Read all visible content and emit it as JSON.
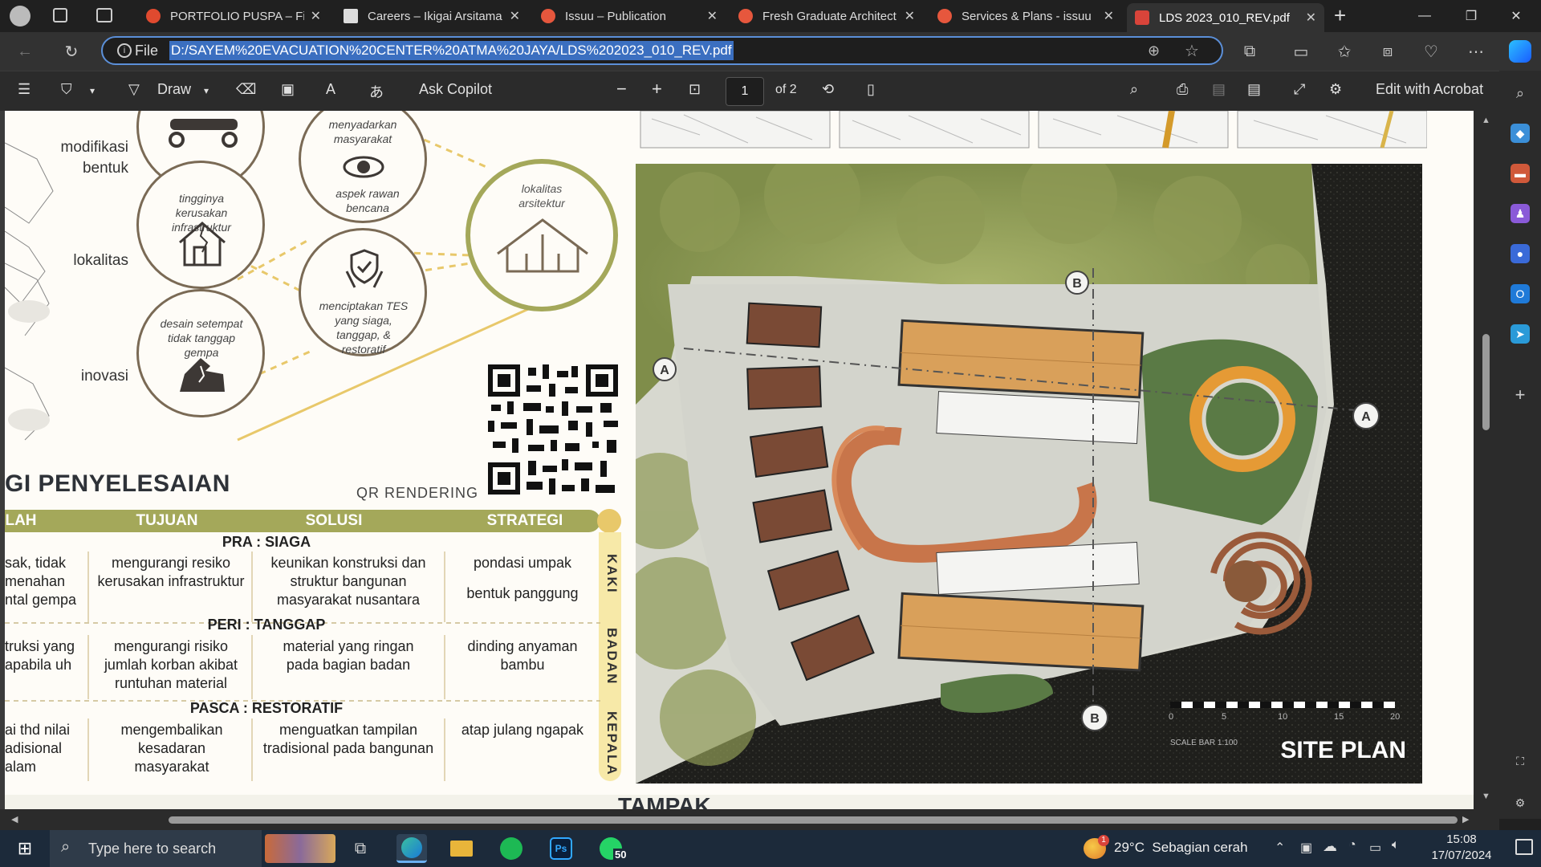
{
  "tabs": [
    {
      "label": "PORTFOLIO PUSPA – Figma",
      "favicon_color": "#e04a2f",
      "active": false
    },
    {
      "label": "Careers – Ikigai Arsitama",
      "favicon_color": "#dddddd",
      "active": false
    },
    {
      "label": "Issuu – Publication",
      "favicon_color": "#e6573d",
      "active": false
    },
    {
      "label": "Fresh Graduate Architect",
      "favicon_color": "#e6573d",
      "active": false
    },
    {
      "label": "Services & Plans - issuu",
      "favicon_color": "#e6573d",
      "active": false
    },
    {
      "label": "LDS 2023_010_REV.pdf",
      "favicon_color": "#d9443a",
      "active": true
    }
  ],
  "address": {
    "scheme_label": "File",
    "url": "D:/SAYEM%20EVACUATION%20CENTER%20ATMA%20JAYA/LDS%202023_010_REV.pdf"
  },
  "pdf_toolbar": {
    "draw_label": "Draw",
    "copilot_label": "Ask Copilot",
    "page_number": "1",
    "page_total": "of 2",
    "edit_label": "Edit with Acrobat"
  },
  "document": {
    "left_labels": [
      "modifikasi bentuk",
      "lokalitas",
      "inovasi"
    ],
    "circles": [
      {
        "text": "tingginya kerusakan infrastruktur"
      },
      {
        "text": "desain setempat tidak tanggap gempa"
      },
      {
        "text": "menyadarkan masyarakat"
      },
      {
        "text": "aspek rawan bencana"
      },
      {
        "text": "menciptakan TES yang siaga, tanggap, & restoratif"
      },
      {
        "text": "lokalitas arsitektur"
      }
    ],
    "heading": "GI PENYELESAIAN",
    "qr_label": "QR RENDERING",
    "table": {
      "headers": [
        "LAH",
        "TUJUAN",
        "SOLUSI",
        "STRATEGI"
      ],
      "sections": [
        {
          "title": "PRA : SIAGA",
          "side_label": "KAKI",
          "cells": [
            "sak, tidak menahan ntal gempa",
            "mengurangi resiko kerusakan infrastruktur",
            "keunikan konstruksi dan struktur bangunan masyarakat nusantara",
            "pondasi umpak",
            "bentuk panggung"
          ]
        },
        {
          "title": "PERI : TANGGAP",
          "side_label": "BADAN",
          "cells": [
            "truksi yang apabila uh",
            "mengurangi risiko jumlah korban akibat runtuhan material",
            "material yang ringan pada bagian badan",
            "dinding anyaman bambu"
          ]
        },
        {
          "title": "PASCA : RESTORATIF",
          "side_label": "KEPALA",
          "cells": [
            "ai thd nilai adisional alam",
            "mengembalikan kesadaran masyarakat",
            "menguatkan tampilan tradisional pada bangunan",
            "atap julang ngapak"
          ]
        }
      ]
    },
    "site_plan_title": "SITE PLAN",
    "scale_caption": "SCALE BAR 1:100",
    "scale_ticks": [
      "0",
      "5",
      "10",
      "15",
      "20"
    ],
    "section_markers": [
      "A",
      "A",
      "B",
      "B"
    ],
    "bottom_heading": "TAMPAK"
  },
  "taskbar": {
    "search_placeholder": "Type here to search",
    "whatsapp_badge": "50",
    "weather": "29°C  Sebagian cerah",
    "weather_alert": "1",
    "time": "15:08",
    "date": "17/07/2024"
  },
  "colors": {
    "accent_olive": "#a4a85a",
    "accent_gold": "#e8c86a",
    "circle_brown": "#7a6a55",
    "selection_blue": "#3b6fc0"
  }
}
